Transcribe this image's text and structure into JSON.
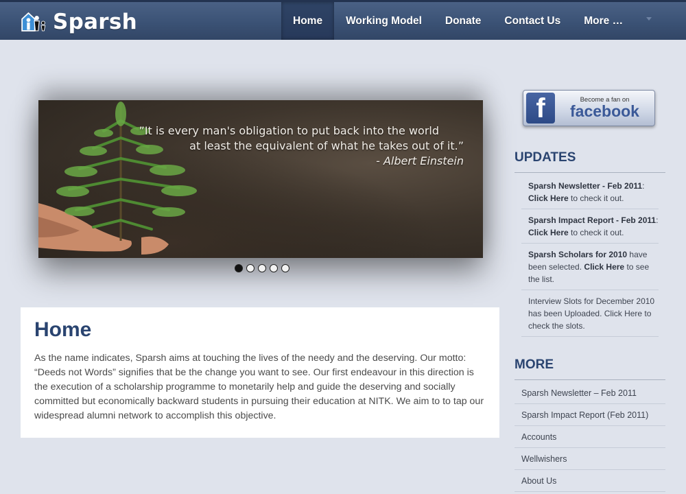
{
  "brand": {
    "name": "Sparsh",
    "logo_icon": "family-house-icon"
  },
  "nav": {
    "items": [
      "Home",
      "Working Model",
      "Donate",
      "Contact Us",
      "More …"
    ],
    "active_index": 0,
    "dropdown_icon": "caret-down-icon"
  },
  "slider": {
    "quote_line1": "”It is every man's obligation to put back into the world",
    "quote_line2": "at least the equivalent of what he takes out of it.”",
    "quote_author": "- Albert Einstein",
    "slide_count": 5,
    "active_slide": 1
  },
  "main": {
    "title": "Home",
    "body": "As the name indicates, Sparsh aims at touching the lives of the needy and the deserving. Our motto: “Deeds not Words” signifies that be the change you want to see. Our first endeavour in this direction is the execution of a scholarship programme to monetarily help and guide the deserving and socially committed but economically backward students in pursuing their education at NITK. We aim to to tap our widespread alumni network to accomplish this objective."
  },
  "facebook": {
    "small": "Become a fan on",
    "big": "facebook",
    "f": "f"
  },
  "updates": {
    "title": "UPDATES",
    "items": [
      {
        "bold": "Sparsh Newsletter - Feb 2011",
        "tail": ":",
        "link": "Click Here",
        "after": " to check it out."
      },
      {
        "bold": "Sparsh Impact Report - Feb 2011",
        "tail": ":",
        "link": "Click Here",
        "after": " to check it out."
      },
      {
        "bold": "Sparsh Scholars for 2010",
        "tail": " have been selected. ",
        "link": "Click Here",
        "after": " to see the list."
      },
      {
        "plain": "Interview Slots for December 2010 has been Uploaded. Click Here to check the slots."
      }
    ]
  },
  "more": {
    "title": "MORE",
    "items": [
      "Sparsh Newsletter – Feb 2011",
      "Sparsh Impact Report (Feb 2011)",
      "Accounts",
      "Wellwishers",
      "About Us"
    ]
  },
  "colors": {
    "nav_bg": "#3b5275",
    "page_bg": "#dfe3ec",
    "heading": "#2a4470",
    "facebook_blue": "#3b5998"
  }
}
